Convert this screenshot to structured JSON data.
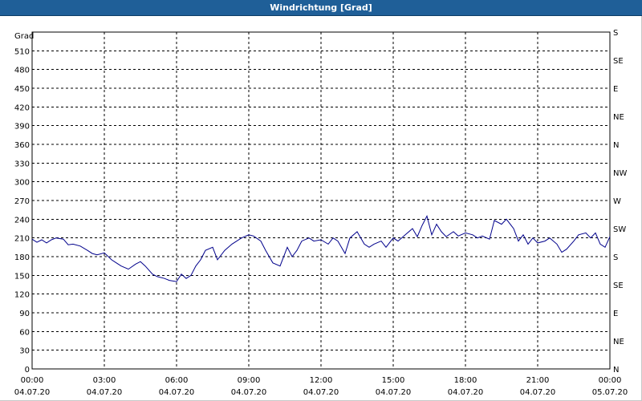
{
  "window": {
    "title": "Windrichtung [Grad]"
  },
  "chart_data": {
    "type": "line",
    "title": "Windrichtung [Grad]",
    "ylabel": "Grad",
    "ylim": [
      0,
      540
    ],
    "y_ticks": [
      0,
      30,
      60,
      90,
      120,
      150,
      180,
      210,
      240,
      270,
      300,
      330,
      360,
      390,
      420,
      450,
      480,
      510
    ],
    "right_labels": [
      "N",
      "NE",
      "E",
      "SE",
      "S",
      "SW",
      "W",
      "NW",
      "N",
      "NE",
      "E",
      "SE",
      "S"
    ],
    "right_ticks": [
      0,
      30,
      60,
      90,
      120,
      150,
      180,
      210,
      240,
      270,
      300,
      330,
      360,
      390,
      420,
      450,
      480,
      510,
      540
    ],
    "x_range_hours": [
      0,
      24
    ],
    "x_ticks": [
      {
        "time": "00:00",
        "date": "04.07.20"
      },
      {
        "time": "03:00",
        "date": "04.07.20"
      },
      {
        "time": "06:00",
        "date": "04.07.20"
      },
      {
        "time": "09:00",
        "date": "04.07.20"
      },
      {
        "time": "12:00",
        "date": "04.07.20"
      },
      {
        "time": "15:00",
        "date": "04.07.20"
      },
      {
        "time": "18:00",
        "date": "04.07.20"
      },
      {
        "time": "21:00",
        "date": "04.07.20"
      },
      {
        "time": "00:00",
        "date": "05.07.20"
      }
    ],
    "grid": true,
    "series": [
      {
        "color": "#00008b",
        "x": [
          0.0,
          0.2,
          0.4,
          0.6,
          0.8,
          1.0,
          1.3,
          1.5,
          1.7,
          2.0,
          2.3,
          2.5,
          2.7,
          3.0,
          3.3,
          3.5,
          3.7,
          4.0,
          4.3,
          4.5,
          4.7,
          5.0,
          5.2,
          5.5,
          5.7,
          6.0,
          6.2,
          6.4,
          6.6,
          6.8,
          7.0,
          7.2,
          7.5,
          7.7,
          8.0,
          8.3,
          8.5,
          8.7,
          9.0,
          9.2,
          9.5,
          9.7,
          10.0,
          10.3,
          10.6,
          10.8,
          11.0,
          11.2,
          11.5,
          11.7,
          12.0,
          12.3,
          12.5,
          12.7,
          13.0,
          13.2,
          13.5,
          13.8,
          14.0,
          14.2,
          14.5,
          14.7,
          15.0,
          15.2,
          15.5,
          15.8,
          16.0,
          16.2,
          16.4,
          16.6,
          16.8,
          17.0,
          17.2,
          17.5,
          17.7,
          18.0,
          18.3,
          18.5,
          18.7,
          19.0,
          19.2,
          19.5,
          19.7,
          20.0,
          20.2,
          20.4,
          20.6,
          20.8,
          21.0,
          21.3,
          21.5,
          21.8,
          22.0,
          22.2,
          22.5,
          22.7,
          23.0,
          23.2,
          23.4,
          23.6,
          23.8,
          24.0
        ],
        "values": [
          208,
          203,
          207,
          202,
          207,
          210,
          208,
          199,
          200,
          197,
          190,
          185,
          183,
          186,
          175,
          170,
          165,
          160,
          168,
          172,
          165,
          152,
          148,
          145,
          142,
          140,
          152,
          145,
          150,
          165,
          175,
          190,
          195,
          175,
          190,
          200,
          205,
          210,
          215,
          213,
          205,
          190,
          170,
          165,
          195,
          180,
          190,
          205,
          210,
          205,
          207,
          200,
          210,
          205,
          185,
          210,
          220,
          200,
          195,
          200,
          205,
          195,
          210,
          205,
          215,
          225,
          212,
          230,
          245,
          215,
          232,
          220,
          212,
          220,
          213,
          218,
          215,
          210,
          213,
          208,
          238,
          232,
          240,
          225,
          205,
          215,
          200,
          210,
          202,
          205,
          210,
          200,
          187,
          192,
          205,
          215,
          218,
          210,
          218,
          200,
          195,
          212
        ]
      }
    ]
  }
}
